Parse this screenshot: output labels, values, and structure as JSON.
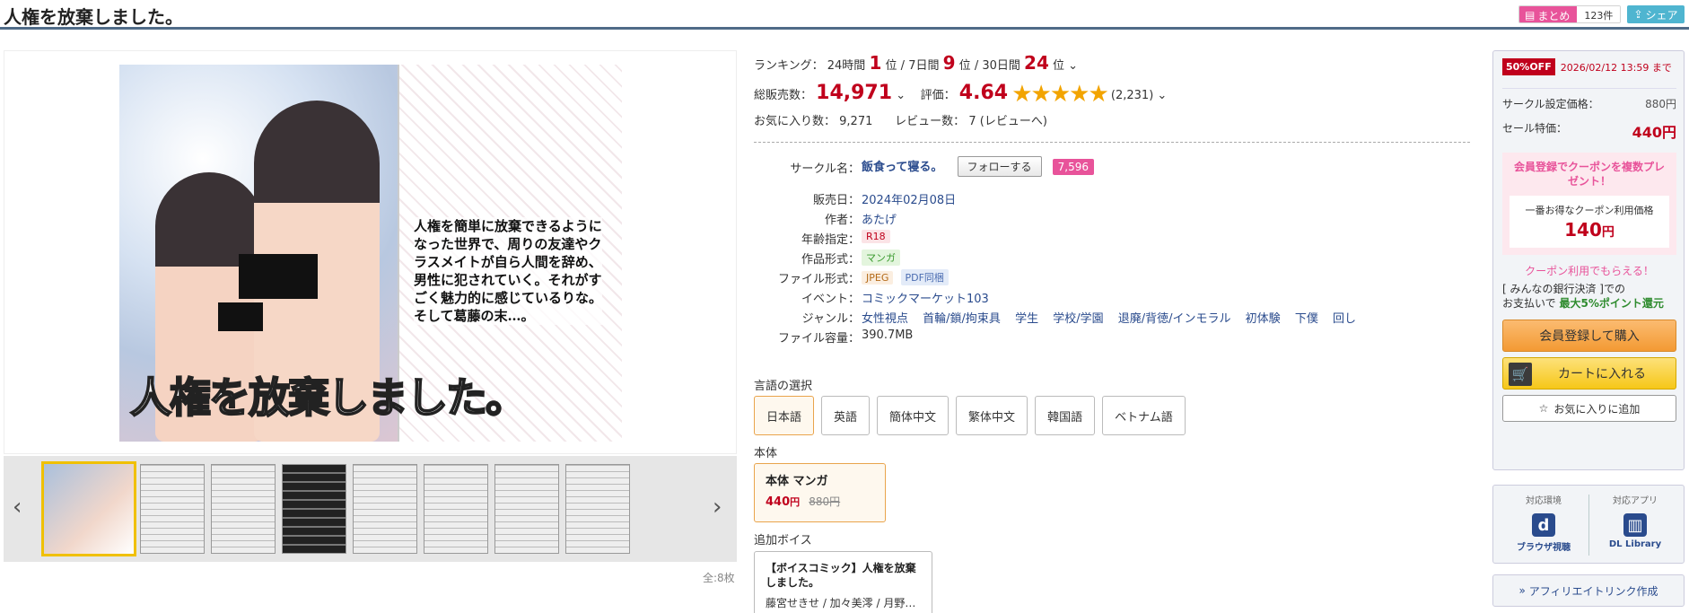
{
  "title": "人権を放棄しました。",
  "header": {
    "matome_label": "まとめ",
    "matome_count": "123件",
    "share_label": "シェア"
  },
  "gallery": {
    "cover_text": "人権を簡単に放棄できるようになった世界で、周りの友達やクラスメイトが自ら人間を辞め、男性に犯されていく。それがすごく魅力的に感じているりな。そして葛藤の末…。",
    "cover_title": "人権を放棄しました。",
    "total": "全:8枚"
  },
  "ranking": {
    "label": "ランキング：",
    "h24_label": "24時間",
    "h24_value": "1",
    "d7_label": "7日間",
    "d7_value": "9",
    "d30_label": "30日間",
    "d30_value": "24",
    "unit": "位"
  },
  "sales": {
    "label": "総販売数：",
    "value": "14,971",
    "rating_label": "評価：",
    "rating_value": "4.64",
    "stars": 5,
    "rating_count": "(2,231)"
  },
  "favorites": {
    "fav_label": "お気に入り数：",
    "fav_value": "9,271",
    "review_label": "レビュー数：",
    "review_value": "7",
    "review_link": "(レビューへ)"
  },
  "spec": {
    "circle_label": "サークル名：",
    "circle_value": "飯食って寝る。",
    "follow_label": "フォローする",
    "follow_count": "7,596",
    "release_label": "販売日：",
    "release_value": "2024年02月08日",
    "author_label": "作者：",
    "author_value": "あたげ",
    "age_label": "年齢指定：",
    "age_value": "R18",
    "type_label": "作品形式：",
    "type_value": "マンガ",
    "file_label": "ファイル形式：",
    "file_value1": "JPEG",
    "file_value2": "PDF同梱",
    "event_label": "イベント：",
    "event_value": "コミックマーケット103",
    "genre_label": "ジャンル：",
    "genres": [
      "女性視点",
      "首輪/鎖/拘束具",
      "学生",
      "学校/学園",
      "退廃/背徳/インモラル",
      "初体験",
      "下僕",
      "回し"
    ],
    "size_label": "ファイル容量：",
    "size_value": "390.7MB"
  },
  "language": {
    "label": "言語の選択",
    "options": [
      "日本語",
      "英語",
      "簡体中文",
      "繁体中文",
      "韓国語",
      "ベトナム語"
    ]
  },
  "honbun": {
    "label": "本体",
    "title": "本体 マンガ",
    "price": "440",
    "yen": "円",
    "old_price": "880円"
  },
  "voice": {
    "label": "追加ボイス",
    "title": "【ボイスコミック】人権を放棄しました。",
    "names": "藤宮せきせ / 加々美澪 / 月野…"
  },
  "purchase": {
    "sale_badge": "50%OFF",
    "sale_until": "2026/02/12 13:59 まで",
    "list_price_label": "サークル設定価格：",
    "list_price": "880円",
    "sale_price_label": "セール特価：",
    "sale_price": "440円",
    "coupon_heading": "会員登録でクーポンを複数プレゼント！",
    "coupon_sub": "一番お得なクーポン利用価格",
    "coupon_price": "140",
    "coupon_yen": "円",
    "coupon_note": "クーポン利用でもらえる！",
    "point_line1": "[ みんなの銀行決済 ]での",
    "point_line2": "お支払いで",
    "point_green": "最大5%ポイント還元",
    "buy_label": "会員登録して購入",
    "cart_label": "カートに入れる",
    "fav_label": "お気に入りに追加"
  },
  "env": {
    "env_label": "対応環境",
    "env_name": "ブラウザ視聴",
    "app_label": "対応アプリ",
    "app_name": "DL Library"
  },
  "affiliate_label": "アフィリエイトリンク作成",
  "colors": {
    "accent_red": "#c0001c",
    "pink": "#e8539a",
    "link_blue": "#2a4b8d",
    "orange_button": "#f39a33",
    "yellow_button": "#f6c718"
  }
}
